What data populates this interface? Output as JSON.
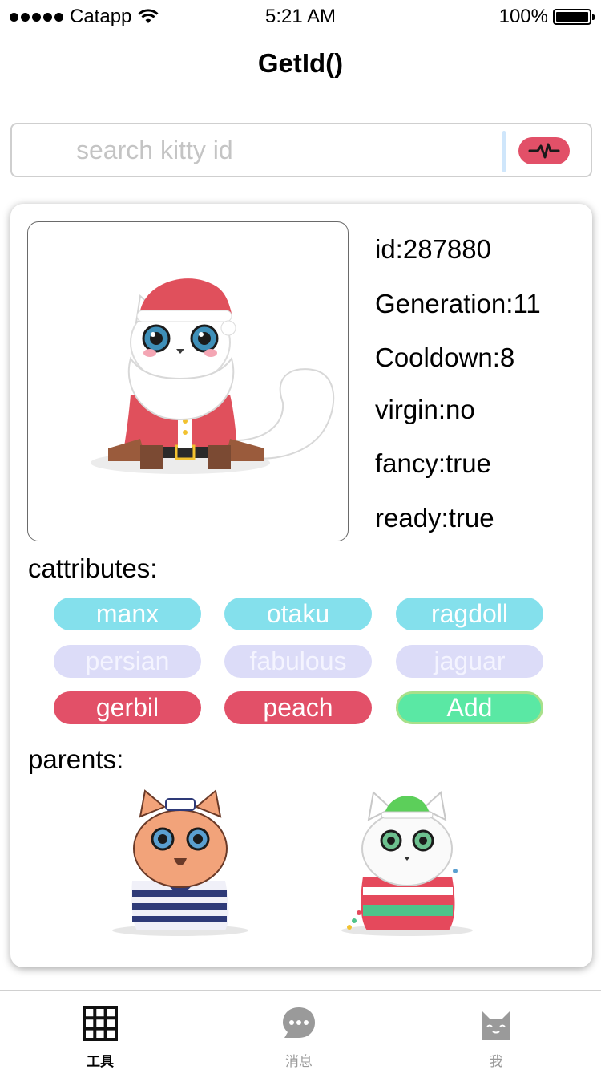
{
  "status_bar": {
    "carrier": "Catapp",
    "time": "5:21 AM",
    "battery": "100%",
    "battery_level": 1.0
  },
  "nav": {
    "title": "GetId()"
  },
  "search": {
    "placeholder": "search kitty id",
    "value": "",
    "button_icon": "heartbeat-icon"
  },
  "kitty": {
    "image": "santa-kitty",
    "id": "id:287880",
    "generation": "Generation:11",
    "cooldown": "Cooldown:8",
    "virgin": "virgin:no",
    "fancy": "fancy:true",
    "ready": "ready:true"
  },
  "cattributes": {
    "label": "cattributes:",
    "tags": [
      {
        "label": "manx",
        "color": "#84e0ec"
      },
      {
        "label": "otaku",
        "color": "#84e0ec"
      },
      {
        "label": "ragdoll",
        "color": "#84e0ec"
      },
      {
        "label": "persian",
        "color": "#dcdcf8"
      },
      {
        "label": "fabulous",
        "color": "#dcdcf8"
      },
      {
        "label": "jaguar",
        "color": "#dcdcf8"
      },
      {
        "label": "gerbil",
        "color": "#e25068"
      },
      {
        "label": "peach",
        "color": "#e25068"
      },
      {
        "label": "Add",
        "color": "#5ae8a4"
      }
    ]
  },
  "parents": {
    "label": "parents:",
    "items": [
      {
        "image": "sailor-kitty"
      },
      {
        "image": "sweater-kitty"
      }
    ]
  },
  "tab_bar": {
    "tabs": [
      {
        "label": "工具",
        "icon": "grid-icon",
        "active": true
      },
      {
        "label": "消息",
        "icon": "chat-bubble-icon",
        "active": false
      },
      {
        "label": "我",
        "icon": "cat-face-icon",
        "active": false
      }
    ]
  }
}
